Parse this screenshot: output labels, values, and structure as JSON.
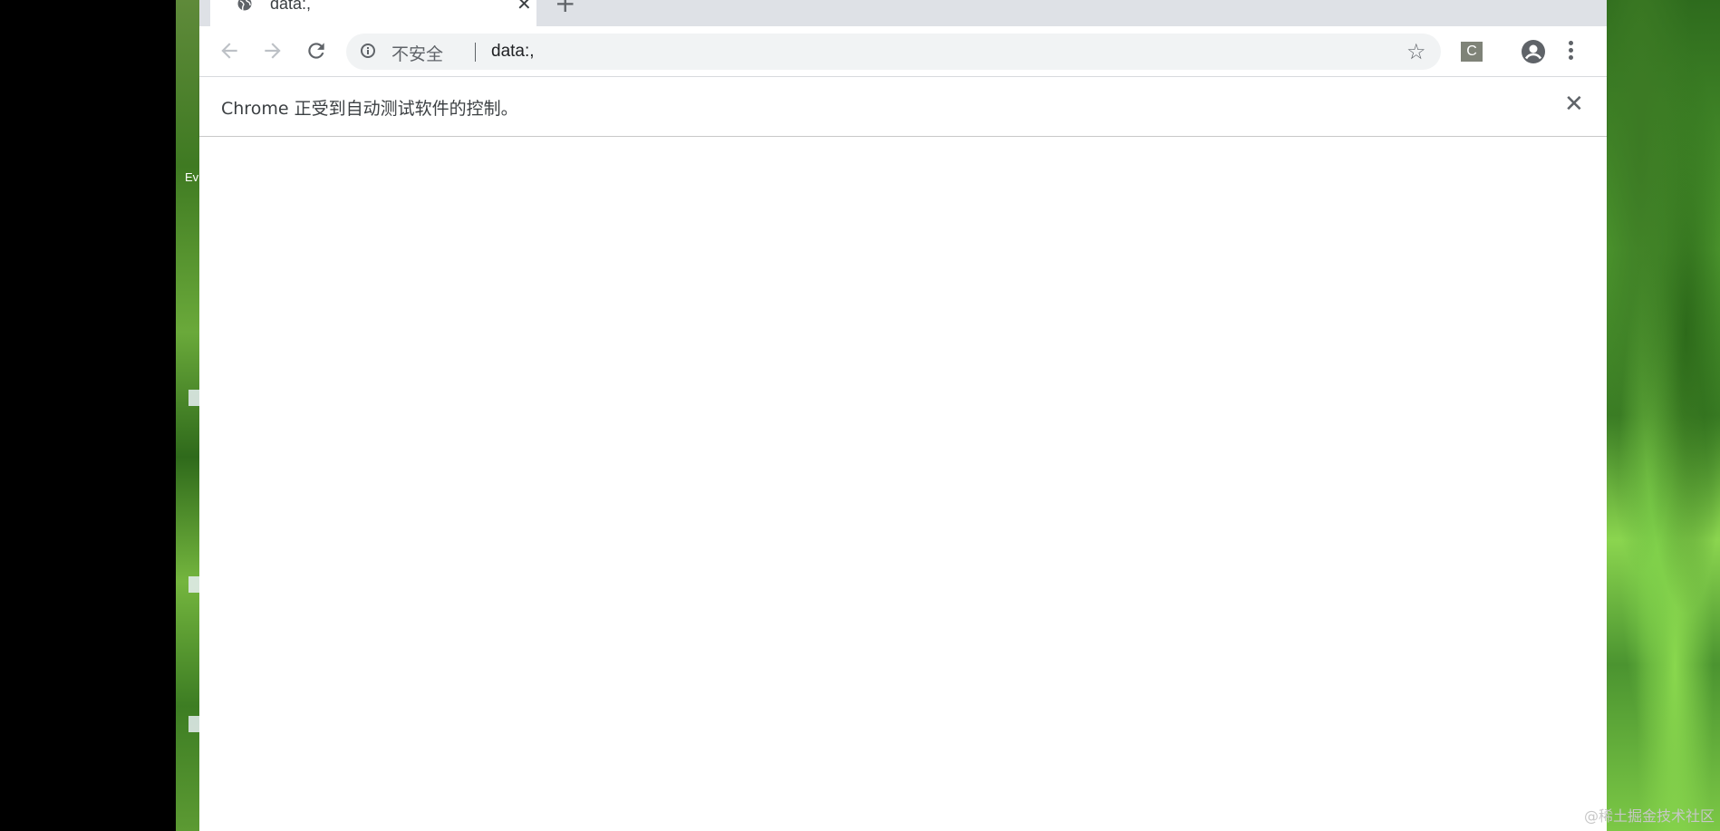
{
  "browser": {
    "tab": {
      "title": "data:,"
    },
    "toolbar": {
      "security_label": "不安全",
      "url": "data:,",
      "extension_label": "C"
    },
    "infobar": {
      "message": "Chrome 正受到自动测试软件的控制。"
    }
  },
  "desktop": {
    "label_ev": "Ev"
  },
  "watermark": "@稀土掘金技术社区",
  "icons": {
    "favicon": "globe-icon",
    "close_tab": "close-icon",
    "new_tab": "plus-icon",
    "back": "arrow-left-icon",
    "forward": "arrow-right-icon",
    "reload": "reload-icon",
    "info": "info-icon",
    "bookmark": "star-icon",
    "profile": "profile-icon",
    "menu": "more-vert-icon",
    "close_infobar": "close-icon"
  },
  "colors": {
    "tabstrip_bg": "#dee1e6",
    "omnibox_bg": "#f1f3f4",
    "ext_icon_bg": "#7f8378"
  }
}
